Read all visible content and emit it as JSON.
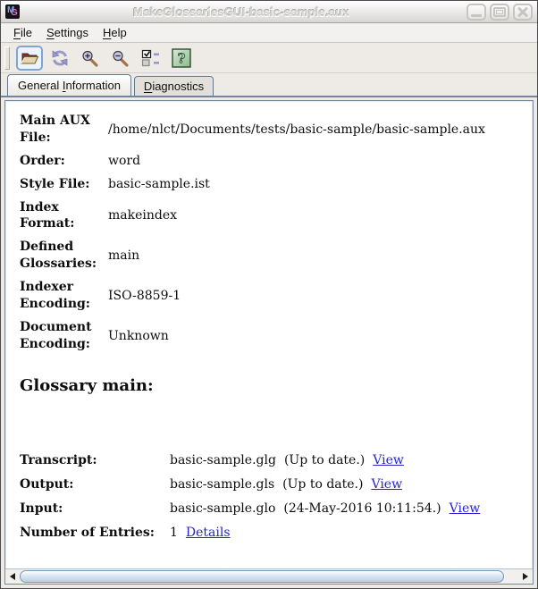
{
  "window": {
    "title": "MakeGlossariesGUI-basic-sample.aux",
    "icon_m": "M",
    "icon_g": "G"
  },
  "menu": {
    "items": [
      {
        "pre": "",
        "mnemonic": "F",
        "rest": "ile"
      },
      {
        "pre": "",
        "mnemonic": "S",
        "rest": "ettings"
      },
      {
        "pre": "",
        "mnemonic": "H",
        "rest": "elp"
      }
    ]
  },
  "toolbar": {
    "buttons": [
      {
        "icon": "open-folder-icon",
        "selected": true
      },
      {
        "icon": "reload-icon",
        "selected": false
      },
      {
        "icon": "zoom-in-icon",
        "selected": false
      },
      {
        "icon": "zoom-out-icon",
        "selected": false
      },
      {
        "icon": "entry-selection-icon",
        "selected": false
      },
      {
        "icon": "help-icon",
        "selected": false
      }
    ],
    "help_glyph": "?"
  },
  "tabs": [
    {
      "pre": "General ",
      "mnemonic": "I",
      "rest": "nformation",
      "selected": true
    },
    {
      "pre": "",
      "mnemonic": "D",
      "rest": "iagnostics",
      "selected": false
    }
  ],
  "general_info": {
    "rows": [
      {
        "label": "Main AUX File:",
        "value": "/home/nlct/Documents/tests/basic-sample/basic-sample.aux"
      },
      {
        "label": "Order:",
        "value": "word"
      },
      {
        "label": "Style File:",
        "value": "basic-sample.ist"
      },
      {
        "label": "Index Format:",
        "value": "makeindex"
      },
      {
        "label": "Defined Glossaries:",
        "value": "main"
      },
      {
        "label": "Indexer Encoding:",
        "value": "ISO-8859-1"
      },
      {
        "label": "Document Encoding:",
        "value": "Unknown"
      }
    ],
    "glossary_heading": "Glossary main:",
    "file_rows": [
      {
        "label": "Transcript:",
        "value": "basic-sample.glg",
        "status": "(Up to date.)",
        "link": "View"
      },
      {
        "label": "Output:",
        "value": "basic-sample.gls",
        "status": "(Up to date.)",
        "link": "View"
      },
      {
        "label": "Input:",
        "value": "basic-sample.glo",
        "status": "(24-May-2016 10:11:54.)",
        "link": "View"
      },
      {
        "label": "Number of Entries:",
        "value": "1",
        "status": "",
        "link": "Details"
      }
    ]
  },
  "colors": {
    "link_blue": "#2323cd",
    "tab_border_line": "#72849c",
    "scrollbar_thumb": "#b9d0e6",
    "help_green": "#9cc49c",
    "icon_purple": "#9898ca",
    "folder_beige": "#e7d6ad"
  }
}
